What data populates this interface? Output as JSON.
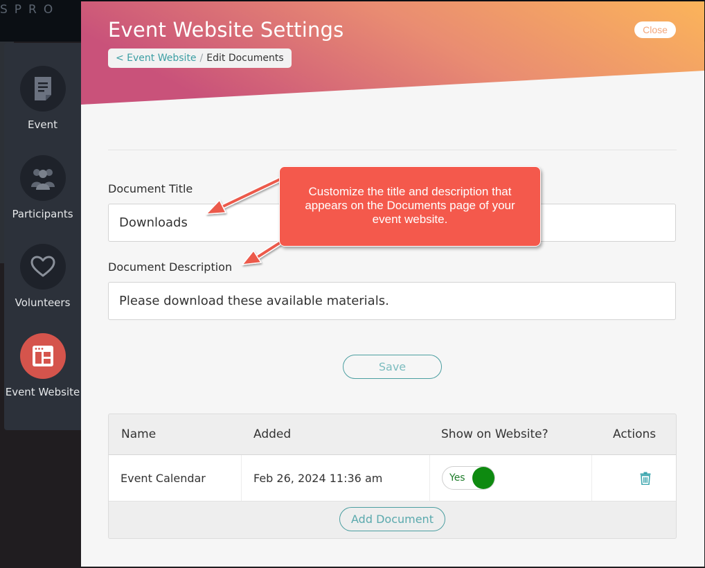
{
  "background": {
    "brand_text": "SPRO"
  },
  "sidebar": {
    "items": [
      {
        "label": "Event",
        "icon": "document-icon",
        "active": false
      },
      {
        "label": "Participants",
        "icon": "participants-icon",
        "active": false
      },
      {
        "label": "Volunteers",
        "icon": "heart-icon",
        "active": false
      },
      {
        "label": "Event Website",
        "icon": "website-layout-icon",
        "active": true
      }
    ]
  },
  "header": {
    "title": "Event Website Settings",
    "close_label": "Close",
    "breadcrumb": {
      "parent": "< Event Website",
      "separator": "/",
      "current": "Edit Documents"
    }
  },
  "form": {
    "title_label": "Document Title",
    "title_value": "Downloads",
    "description_label": "Document Description",
    "description_value": "Please download these available materials.",
    "save_label": "Save"
  },
  "table": {
    "headers": [
      "Name",
      "Added",
      "Show on Website?",
      "Actions"
    ],
    "rows": [
      {
        "name": "Event Calendar",
        "added": "Feb 26, 2024 11:36 am",
        "show_label": "Yes",
        "show_on_website": true
      }
    ],
    "add_label": "Add Document"
  },
  "callout": {
    "text": "Customize the title and description that appears on the Documents page of your event website."
  },
  "colors": {
    "header_gradient_start": "#c9527a",
    "header_gradient_mid": "#e98c72",
    "header_gradient_end": "#fbb45a",
    "accent_teal": "#4a9ea0",
    "active_nav": "#d5544c",
    "toggle_on": "#0e8a10",
    "callout": "#f4594c"
  }
}
